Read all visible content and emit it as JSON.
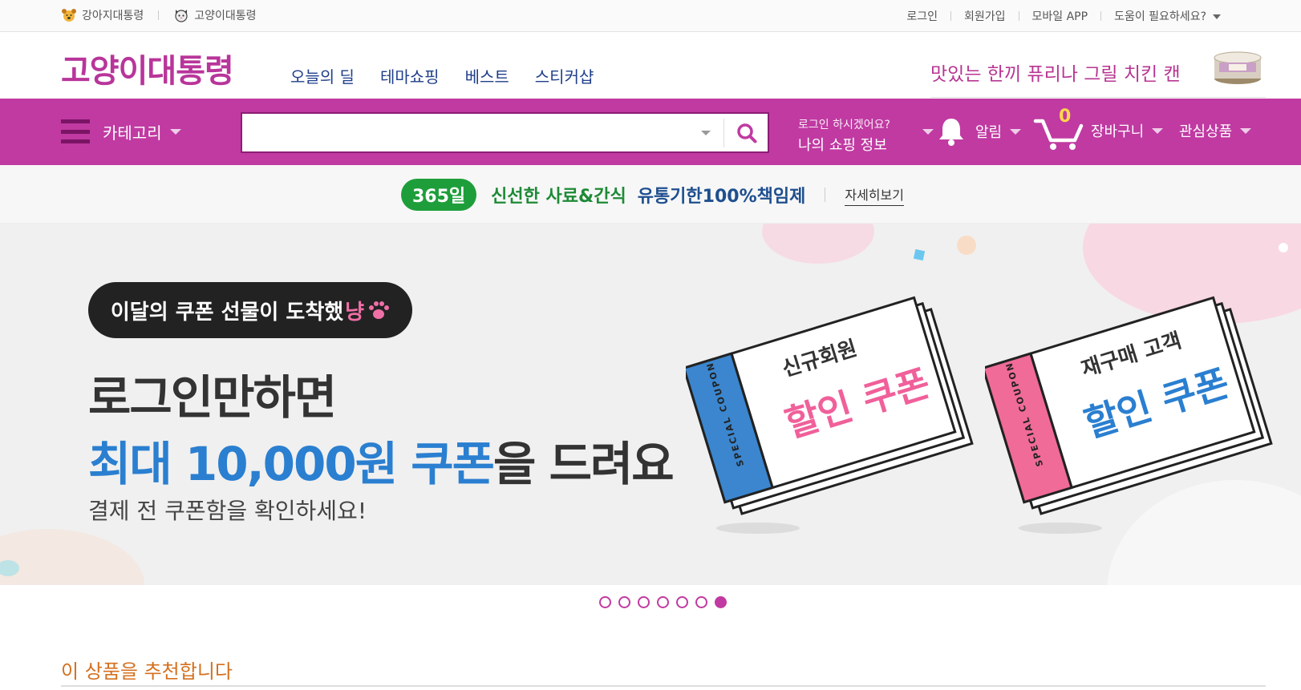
{
  "topbar": {
    "sites": [
      {
        "label": "강아지대통령",
        "icon": "dog-face-icon"
      },
      {
        "label": "고양이대통령",
        "icon": "cat-face-icon"
      }
    ],
    "links": [
      "로그인",
      "회원가입",
      "모바일 APP",
      "도움이 필요하세요?"
    ]
  },
  "header": {
    "logo": "고양이대통령",
    "nav": [
      "오늘의 딜",
      "테마쇼핑",
      "베스트",
      "스티커샵"
    ],
    "promo": "맛있는 한끼 퓨리나 그릴 치킨 캔"
  },
  "navbar": {
    "category": "카테고리",
    "search_value": "",
    "login_prompt": "로그인 하시겠어요?",
    "my_shopping": "나의 쇼핑 정보",
    "notification": "알림",
    "cart_count": "0",
    "cart": "장바구니",
    "wishlist": "관심상품"
  },
  "notice": {
    "badge": "365일",
    "green": "신선한 사료&간식",
    "blue": "유통기한100%책임제",
    "link": "자세히보기"
  },
  "banner": {
    "pill_text": "이달의 쿠폰 선물이 도착했",
    "pill_emph": "냥",
    "headline1": "로그인만하면",
    "headline2_prefix": "최대 10,000원 쿠폰",
    "headline2_suffix": "을 드려요",
    "subtext": "결제 전 쿠폰함을 확인하세요!",
    "coupons": [
      {
        "stub_text": "SPECIAL COUPON",
        "title": "신규회원",
        "discount": "할인 쿠폰",
        "stub_color": "#3b86cf",
        "text_color": "#f0609a"
      },
      {
        "stub_text": "SPECIAL COUPON",
        "title": "재구매 고객",
        "discount": "할인 쿠폰",
        "stub_color": "#f06b98",
        "text_color": "#2a7fd0"
      }
    ],
    "slide_count": 7,
    "active_slide": 7
  },
  "section": {
    "recommend_title": "이 상품을 추천합니다"
  },
  "colors": {
    "brand": "#c03aa2",
    "logo": "#b8359a",
    "nav_text": "#1f3f8a",
    "notice_green": "#1e9e3a",
    "accent_blue": "#2a7fd0",
    "accent_pink": "#f06fa6",
    "section_title": "#d4701f"
  }
}
